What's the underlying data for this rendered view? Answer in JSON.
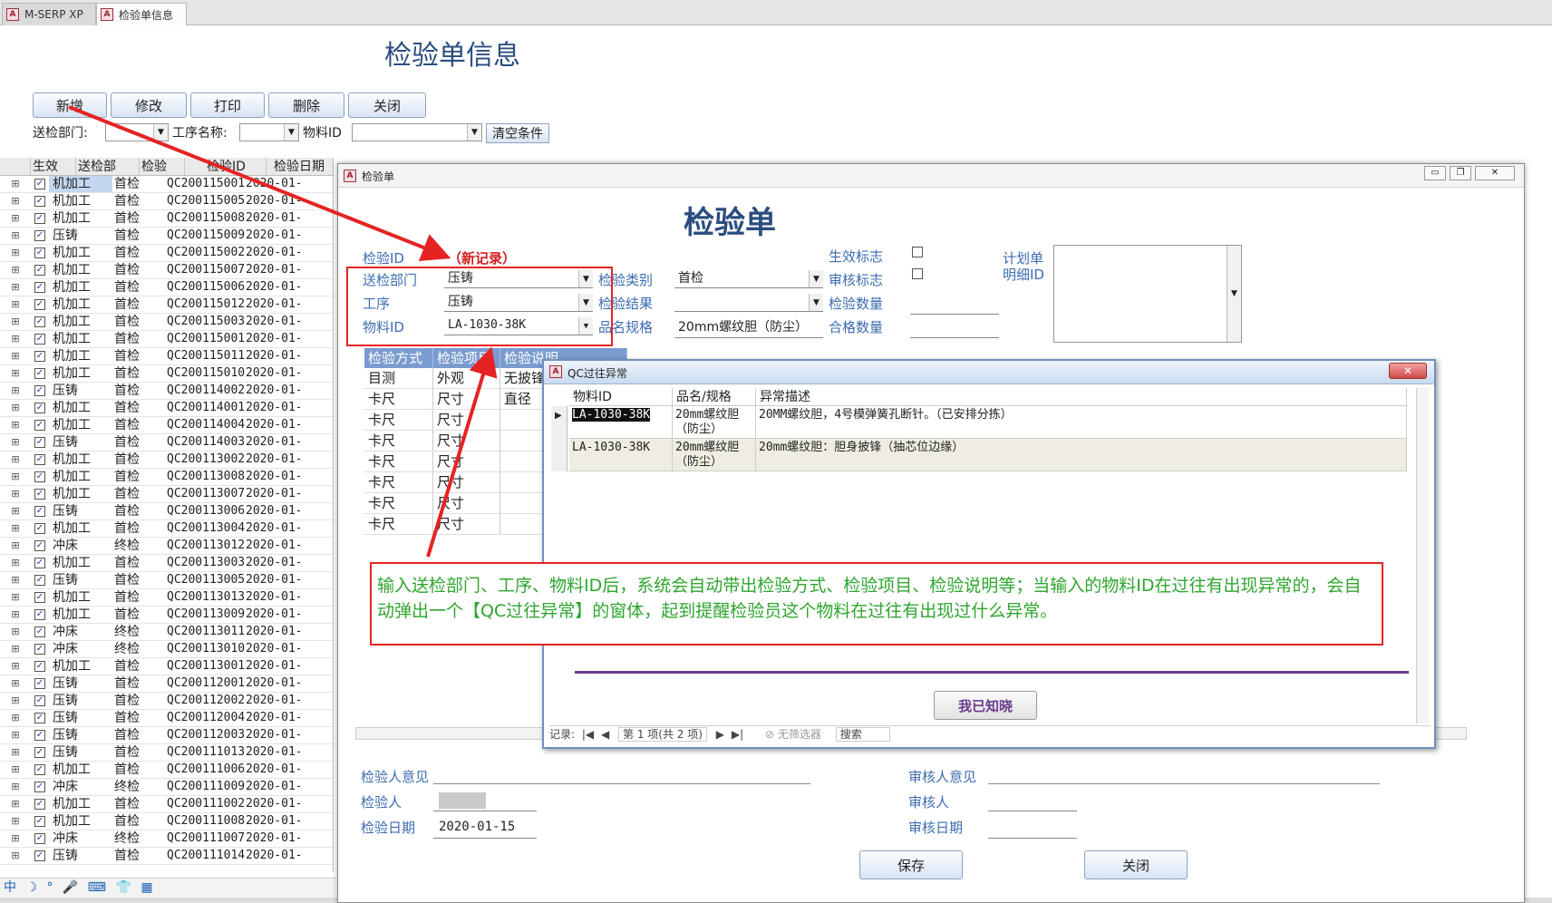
{
  "tabs": [
    {
      "label": "M-SERP XP"
    },
    {
      "label": "检验单信息"
    }
  ],
  "main": {
    "title": "检验单信息",
    "buttons": {
      "new": "新增",
      "edit": "修改",
      "print": "打印",
      "delete": "删除",
      "close": "关闭"
    },
    "filters": {
      "dept_label": "送检部门:",
      "dept_value": "",
      "process_label": "工序名称:",
      "process_value": "",
      "material_label": "物料ID",
      "material_value": "",
      "clear_label": "清空条件"
    }
  },
  "list": {
    "headers": [
      "生效",
      "送检部",
      "检验",
      "检验ID",
      "检验日期"
    ],
    "rows": [
      {
        "dept": "机加工",
        "type": "首检",
        "id": "QC200115001",
        "date": "2020-01-"
      },
      {
        "dept": "机加工",
        "type": "首检",
        "id": "QC200115005",
        "date": "2020-01-"
      },
      {
        "dept": "机加工",
        "type": "首检",
        "id": "QC200115008",
        "date": "2020-01-"
      },
      {
        "dept": "压铸",
        "type": "首检",
        "id": "QC200115009",
        "date": "2020-01-"
      },
      {
        "dept": "机加工",
        "type": "首检",
        "id": "QC200115002",
        "date": "2020-01-"
      },
      {
        "dept": "机加工",
        "type": "首检",
        "id": "QC200115007",
        "date": "2020-01-"
      },
      {
        "dept": "机加工",
        "type": "首检",
        "id": "QC200115006",
        "date": "2020-01-"
      },
      {
        "dept": "机加工",
        "type": "首检",
        "id": "QC200115012",
        "date": "2020-01-"
      },
      {
        "dept": "机加工",
        "type": "首检",
        "id": "QC200115003",
        "date": "2020-01-"
      },
      {
        "dept": "机加工",
        "type": "首检",
        "id": "QC200115001",
        "date": "2020-01-"
      },
      {
        "dept": "机加工",
        "type": "首检",
        "id": "QC200115011",
        "date": "2020-01-"
      },
      {
        "dept": "机加工",
        "type": "首检",
        "id": "QC200115010",
        "date": "2020-01-"
      },
      {
        "dept": "压铸",
        "type": "首检",
        "id": "QC200114002",
        "date": "2020-01-"
      },
      {
        "dept": "机加工",
        "type": "首检",
        "id": "QC200114001",
        "date": "2020-01-"
      },
      {
        "dept": "机加工",
        "type": "首检",
        "id": "QC200114004",
        "date": "2020-01-"
      },
      {
        "dept": "压铸",
        "type": "首检",
        "id": "QC200114003",
        "date": "2020-01-"
      },
      {
        "dept": "机加工",
        "type": "首检",
        "id": "QC200113002",
        "date": "2020-01-"
      },
      {
        "dept": "机加工",
        "type": "首检",
        "id": "QC200113008",
        "date": "2020-01-"
      },
      {
        "dept": "机加工",
        "type": "首检",
        "id": "QC200113007",
        "date": "2020-01-"
      },
      {
        "dept": "压铸",
        "type": "首检",
        "id": "QC200113006",
        "date": "2020-01-"
      },
      {
        "dept": "机加工",
        "type": "首检",
        "id": "QC200113004",
        "date": "2020-01-"
      },
      {
        "dept": "冲床",
        "type": "终检",
        "id": "QC200113012",
        "date": "2020-01-"
      },
      {
        "dept": "机加工",
        "type": "首检",
        "id": "QC200113003",
        "date": "2020-01-"
      },
      {
        "dept": "压铸",
        "type": "首检",
        "id": "QC200113005",
        "date": "2020-01-"
      },
      {
        "dept": "机加工",
        "type": "首检",
        "id": "QC200113013",
        "date": "2020-01-"
      },
      {
        "dept": "机加工",
        "type": "首检",
        "id": "QC200113009",
        "date": "2020-01-"
      },
      {
        "dept": "冲床",
        "type": "终检",
        "id": "QC200113011",
        "date": "2020-01-"
      },
      {
        "dept": "冲床",
        "type": "终检",
        "id": "QC200113010",
        "date": "2020-01-"
      },
      {
        "dept": "机加工",
        "type": "首检",
        "id": "QC200113001",
        "date": "2020-01-"
      },
      {
        "dept": "压铸",
        "type": "首检",
        "id": "QC200112001",
        "date": "2020-01-"
      },
      {
        "dept": "压铸",
        "type": "首检",
        "id": "QC200112002",
        "date": "2020-01-"
      },
      {
        "dept": "压铸",
        "type": "首检",
        "id": "QC200112004",
        "date": "2020-01-"
      },
      {
        "dept": "压铸",
        "type": "首检",
        "id": "QC200112003",
        "date": "2020-01-"
      },
      {
        "dept": "压铸",
        "type": "首检",
        "id": "QC200111013",
        "date": "2020-01-"
      },
      {
        "dept": "机加工",
        "type": "首检",
        "id": "QC200111006",
        "date": "2020-01-"
      },
      {
        "dept": "冲床",
        "type": "终检",
        "id": "QC200111009",
        "date": "2020-01-"
      },
      {
        "dept": "机加工",
        "type": "首检",
        "id": "QC200111002",
        "date": "2020-01-"
      },
      {
        "dept": "机加工",
        "type": "首检",
        "id": "QC200111008",
        "date": "2020-01-"
      },
      {
        "dept": "冲床",
        "type": "终检",
        "id": "QC200111007",
        "date": "2020-01-"
      },
      {
        "dept": "压铸",
        "type": "首检",
        "id": "QC200111014",
        "date": "2020-01-"
      }
    ]
  },
  "form": {
    "window_title": "检验单",
    "title": "检验单",
    "fields": {
      "id_label": "检验ID",
      "id_value": "（新记录）",
      "dept_label": "送检部门",
      "dept_value": "压铸",
      "process_label": "工序",
      "process_value": "压铸",
      "material_label": "物料ID",
      "material_value": "LA-1030-38K",
      "category_label": "检验类别",
      "category_value": "首检",
      "result_label": "检验结果",
      "result_value": "",
      "spec_label": "品名规格",
      "spec_value": "20mm螺纹胆（防尘）",
      "effective_label": "生效标志",
      "audit_flag_label": "审核标志",
      "qty_label": "检验数量",
      "pass_label": "合格数量",
      "plan_label_1": "计划单",
      "plan_label_2": "明细ID"
    },
    "subgrid": {
      "headers": [
        "检验方式",
        "检验项目",
        "检验说明"
      ],
      "rows": [
        {
          "method": "目测",
          "item": "外观",
          "desc": "无披锋"
        },
        {
          "method": "卡尺",
          "item": "尺寸",
          "desc": "直径"
        },
        {
          "method": "卡尺",
          "item": "尺寸",
          "desc": ""
        },
        {
          "method": "卡尺",
          "item": "尺寸",
          "desc": ""
        },
        {
          "method": "卡尺",
          "item": "尺寸",
          "desc": ""
        },
        {
          "method": "卡尺",
          "item": "尺寸",
          "desc": ""
        },
        {
          "method": "卡尺",
          "item": "尺寸",
          "desc": ""
        },
        {
          "method": "卡尺",
          "item": "尺寸",
          "desc": ""
        }
      ]
    },
    "bottom": {
      "inspector_opinion_label": "检验人意见",
      "inspector_label": "检验人",
      "inspect_date_label": "检验日期",
      "inspect_date_value": "2020-01-15",
      "auditor_opinion_label": "审核人意见",
      "auditor_label": "审核人",
      "audit_date_label": "审核日期",
      "save_label": "保存",
      "close_label": "关闭"
    }
  },
  "qc_popup": {
    "title": "QC过往异常",
    "headers": [
      "物料ID",
      "品名/规格",
      "异常描述"
    ],
    "rows": [
      {
        "id": "LA-1030-38K",
        "spec_line1": "20mm螺纹胆",
        "spec_line2": "（防尘）",
        "desc": "20MM螺纹胆，4号模弹簧孔断针。（已安排分拣）"
      },
      {
        "id": "LA-1030-38K",
        "spec_line1": "20mm螺纹胆",
        "spec_line2": "（防尘）",
        "desc": "20mm螺纹胆：胆身披锋（抽芯位边缘）"
      }
    ],
    "ack_label": "我已知晓",
    "nav": {
      "record_label": "记录:",
      "record_pos": "第 1 项(共 2 项)",
      "filter_label": "无筛选器",
      "search_label": "搜索"
    }
  },
  "annotation": {
    "text": "输入送检部门、工序、物料ID后，系统会自动带出检验方式、检验项目、检验说明等；当输入的物料ID在过往有出现异常的，会自动弹出一个【QC过往异常】的窗体，起到提醒检验员这个物料在过往有出现过什么异常。"
  },
  "taskbar": {
    "text": "中 ☽ ° 🎤 ⌨ 👕 ▦"
  },
  "colors": {
    "title_blue": "#2b4d7e",
    "label_blue": "#3d6cb0",
    "annotation_red": "#e52323",
    "annotation_green": "#2fa52f",
    "grid_header": "#7a9bcf",
    "popup_line": "#6e3c8e"
  }
}
